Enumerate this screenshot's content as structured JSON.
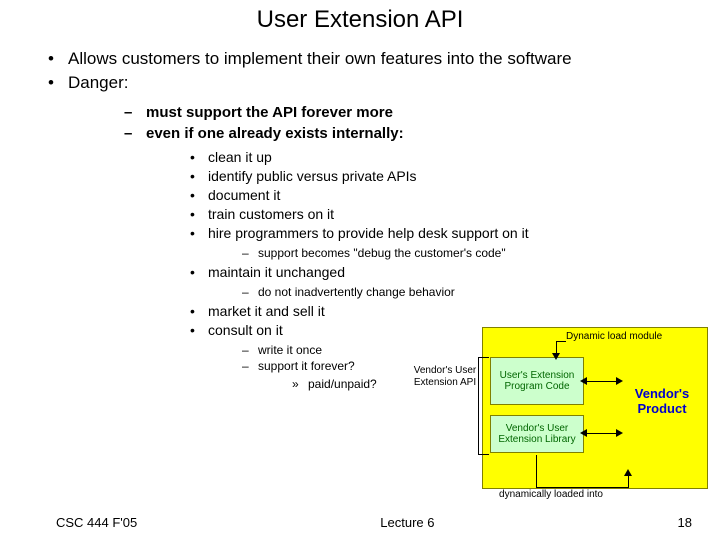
{
  "title": "User Extension API",
  "b1": "Allows customers to implement their own features into the software",
  "b2": "Danger:",
  "d1": "must support the API forever more",
  "d2": "even if one already exists internally:",
  "s1": "clean it up",
  "s2": "identify public versus private APIs",
  "s3": "document it",
  "s4": "train customers on it",
  "s5": "hire programmers to provide help desk support on it",
  "sd1": "support becomes \"debug the customer's code\"",
  "s6": "maintain it unchanged",
  "sd2": "do not inadvertently change behavior",
  "s7": "market it and sell it",
  "s8": "consult on it",
  "sd3": "write it once",
  "sd4": "support it forever?",
  "sa1": "paid/unpaid?",
  "footer_left": "CSC 444 F'05",
  "footer_center": "Lecture 6",
  "footer_right": "18",
  "diagram": {
    "dyn_module": "Dynamic load module",
    "gb1": "User's Extension Program Code",
    "gb2": "Vendor's User Extension Library",
    "api": "Vendor's User Extension API",
    "vendor": "Vendor's Product",
    "dyn_loaded": "dynamically loaded into"
  }
}
